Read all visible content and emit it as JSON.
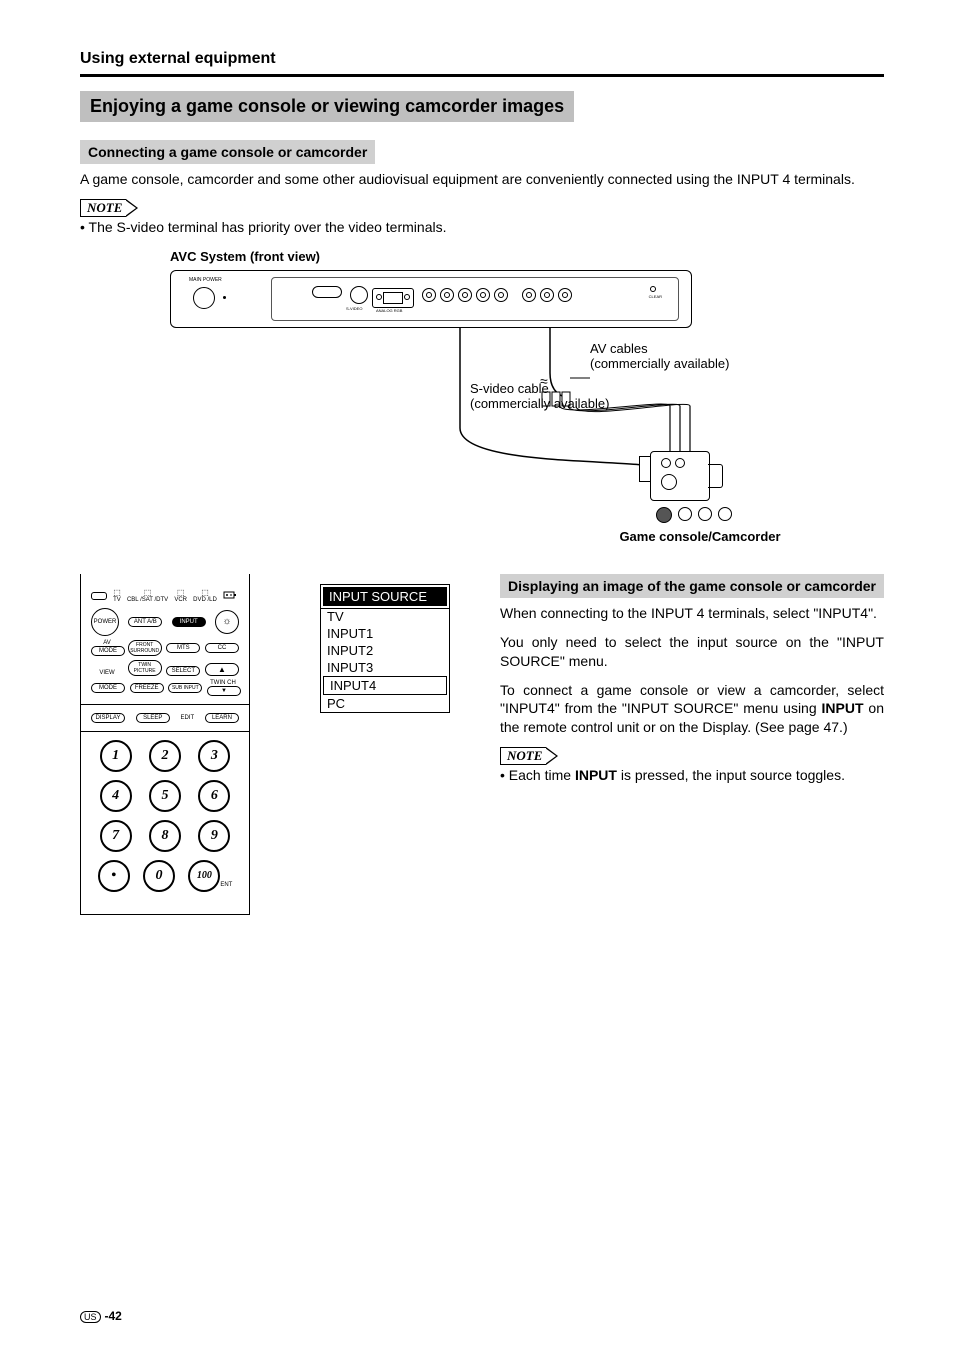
{
  "header": {
    "section": "Using external equipment"
  },
  "title": "Enjoying a game console or viewing camcorder images",
  "sub1": {
    "heading": "Connecting a game console or camcorder",
    "text": "A game console, camcorder and some other audiovisual equipment are conveniently connected using the INPUT 4 terminals."
  },
  "note1": {
    "label": "NOTE",
    "bullet": "The S-video terminal has priority over the video terminals."
  },
  "figure": {
    "avc_caption": "AVC System (front view)",
    "avc_main_power": "MAIN POWER",
    "avc_labels": {
      "sv": "S-VIDEO",
      "analog": "ANALOG RGB",
      "clear": "CLEAR"
    },
    "av_cable": "AV cables",
    "av_cable_sub": "(commercially available)",
    "sv_cable": "S-video cable",
    "sv_cable_sub": "(commercially available)",
    "device_caption": "Game console/Camcorder"
  },
  "menu": {
    "header": "INPUT SOURCE",
    "items": [
      "TV",
      "INPUT1",
      "INPUT2",
      "INPUT3",
      "INPUT4",
      "PC"
    ],
    "selected_index": 4
  },
  "sub2": {
    "heading": "Displaying an image of the game console or camcorder",
    "p1": "When connecting to the INPUT 4 terminals, select \"INPUT4\".",
    "p2": "You only need to select the input source on the \"INPUT SOURCE\" menu.",
    "p3a": "To connect a game console or view a camcorder, select \"INPUT4\" from the \"INPUT SOURCE\" menu using ",
    "p3b": "INPUT",
    "p3c": " on the remote control unit or on the Display. (See page 47.)"
  },
  "note2": {
    "label": "NOTE",
    "bullet_a": "Each time ",
    "bullet_b": "INPUT",
    "bullet_c": " is pressed, the input source toggles."
  },
  "remote": {
    "top_labels": [
      "TV",
      "CBL /SAT /DTV",
      "VCR",
      "DVD /LD"
    ],
    "row1": [
      "POWER",
      "ANT A/B",
      "INPUT"
    ],
    "row2_left": [
      "AV",
      "MODE"
    ],
    "row2": [
      "FRONT SURROUND",
      "MTS",
      "CC"
    ],
    "row3_left": "VIEW",
    "row3_top": [
      "TWIN PICTURE",
      "SELECT"
    ],
    "row3_bot_left": "MODE",
    "row3_bot": [
      "FREEZE",
      "SUB INPUT",
      "TWIN CH"
    ],
    "row4": [
      "DISPLAY",
      "SLEEP",
      "EDIT",
      "LEARN"
    ],
    "numbers": [
      "1",
      "2",
      "3",
      "4",
      "5",
      "6",
      "7",
      "8",
      "9",
      "•",
      "0",
      "100"
    ],
    "ent": "ENT"
  },
  "footer": {
    "region": "US",
    "page": "-42"
  }
}
